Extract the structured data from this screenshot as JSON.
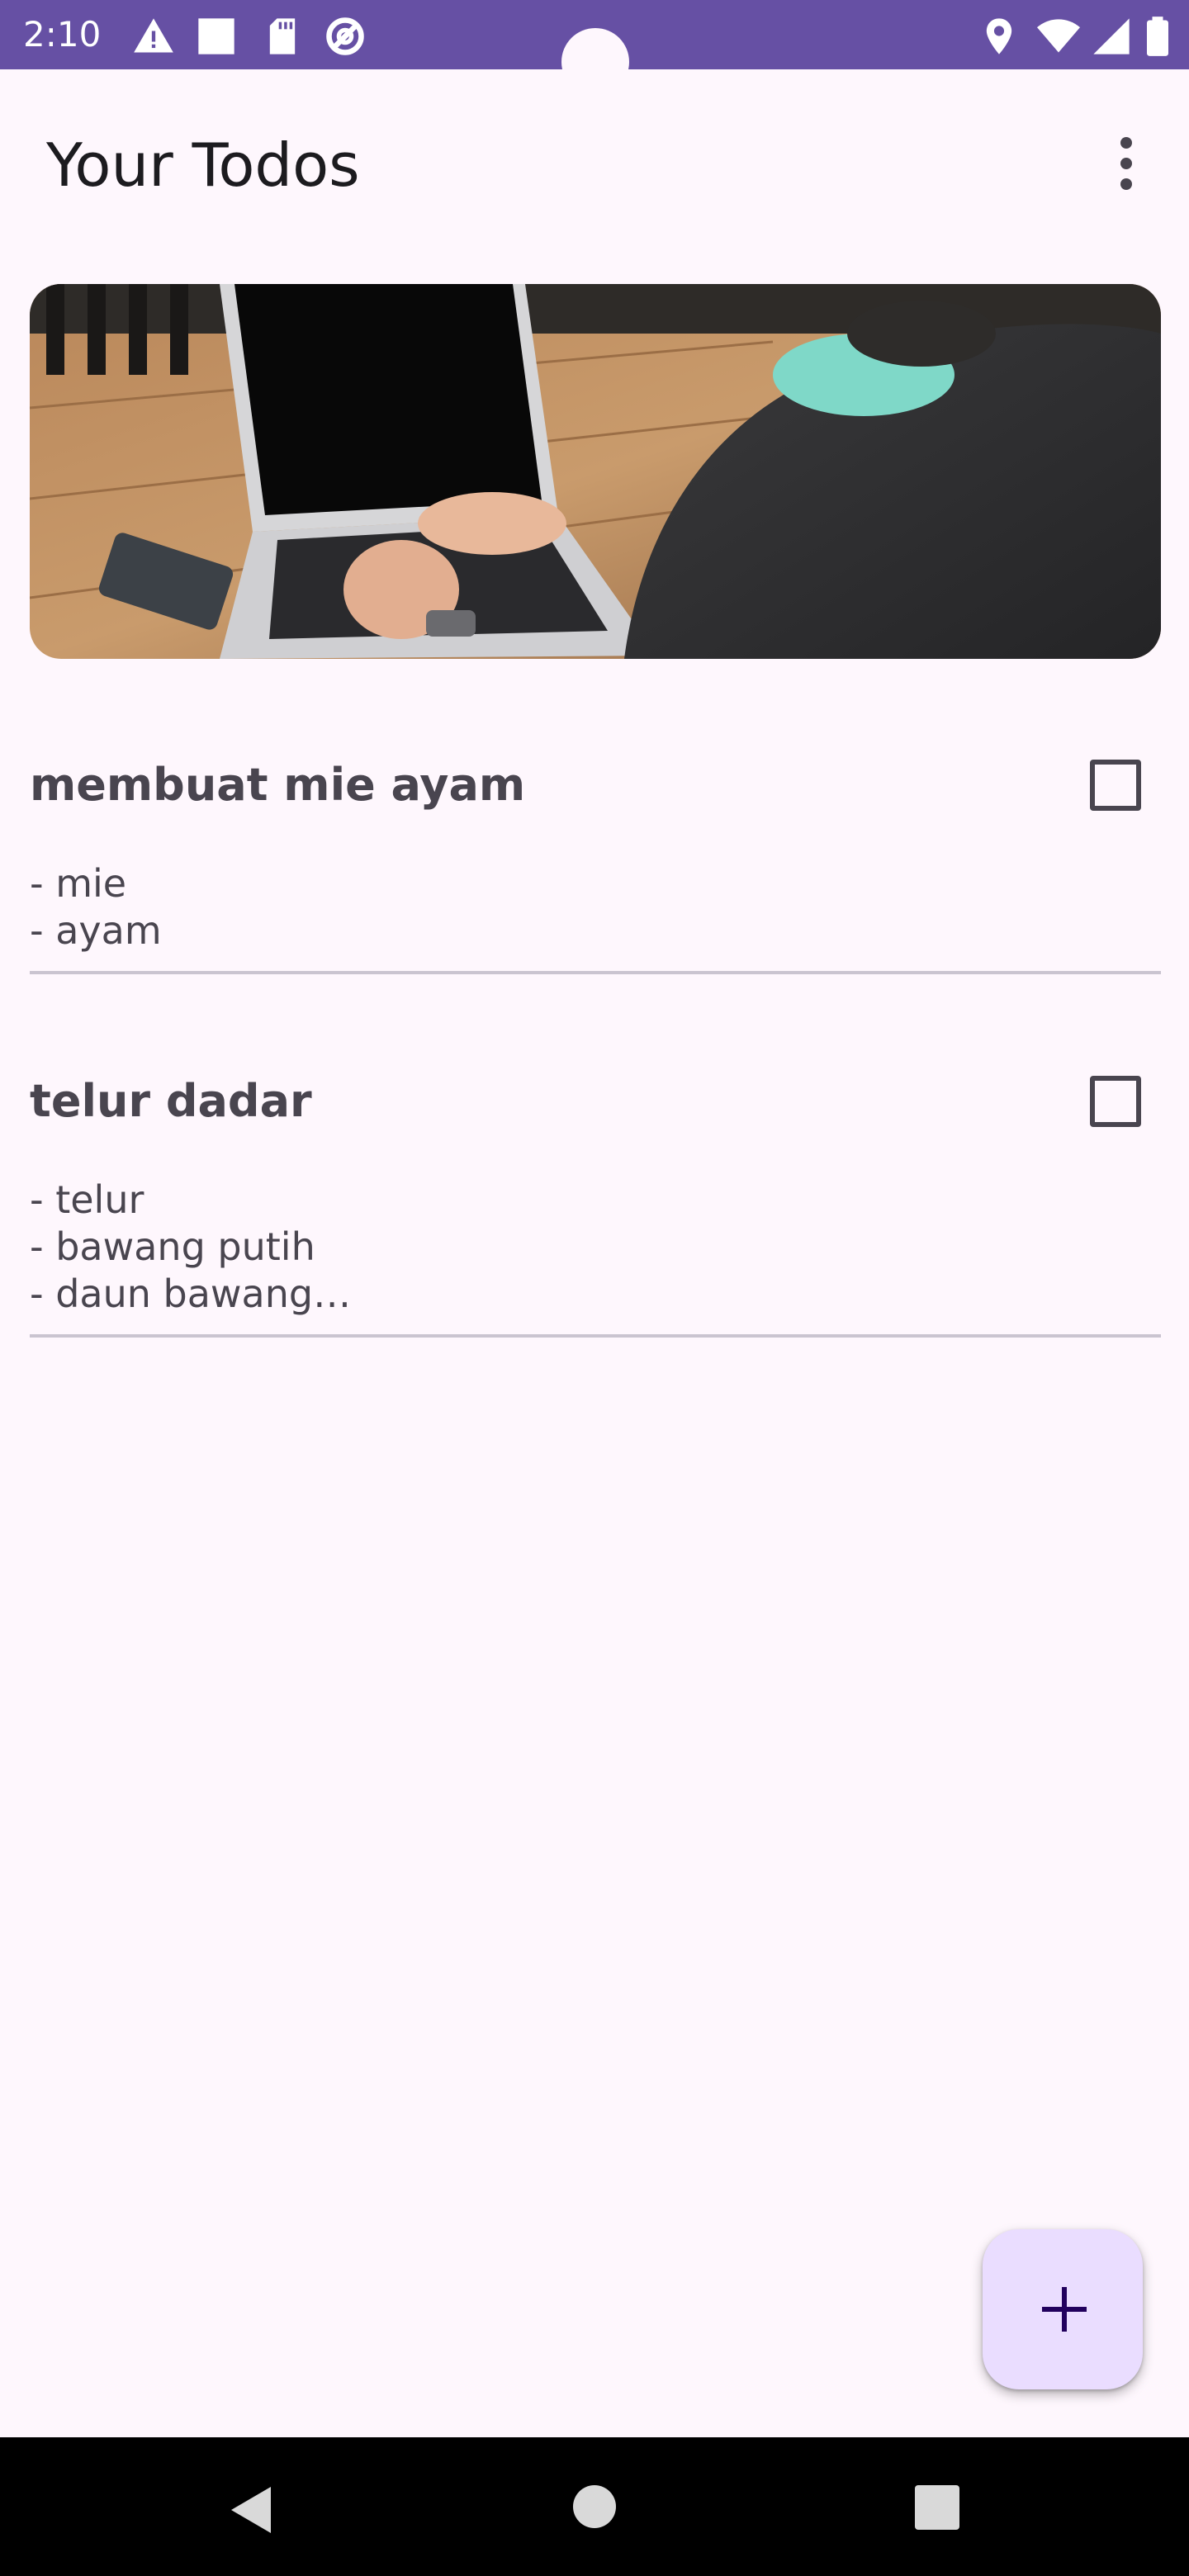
{
  "status_bar": {
    "time": "2:10",
    "left_icons": [
      "warning-icon",
      "square-icon",
      "sd-card-icon",
      "vpn-icon"
    ],
    "right_icons": [
      "location-icon",
      "wifi-icon",
      "signal-icon",
      "battery-icon"
    ],
    "color": "#6650A4"
  },
  "app_bar": {
    "title": "Your Todos",
    "overflow_icon": "more-vert-icon"
  },
  "banner": {
    "image": "laptop-on-wooden-desk-photo"
  },
  "todos": [
    {
      "title": "membuat mie ayam",
      "description": "- mie\n- ayam",
      "checked": false
    },
    {
      "title": "telur dadar",
      "description": "- telur\n- bawang putih\n- daun bawang…",
      "checked": false
    }
  ],
  "fab": {
    "icon": "add-icon",
    "color": "#EADDFF"
  },
  "nav_bar": {
    "icons": [
      "back-icon",
      "home-icon",
      "recents-icon"
    ]
  }
}
